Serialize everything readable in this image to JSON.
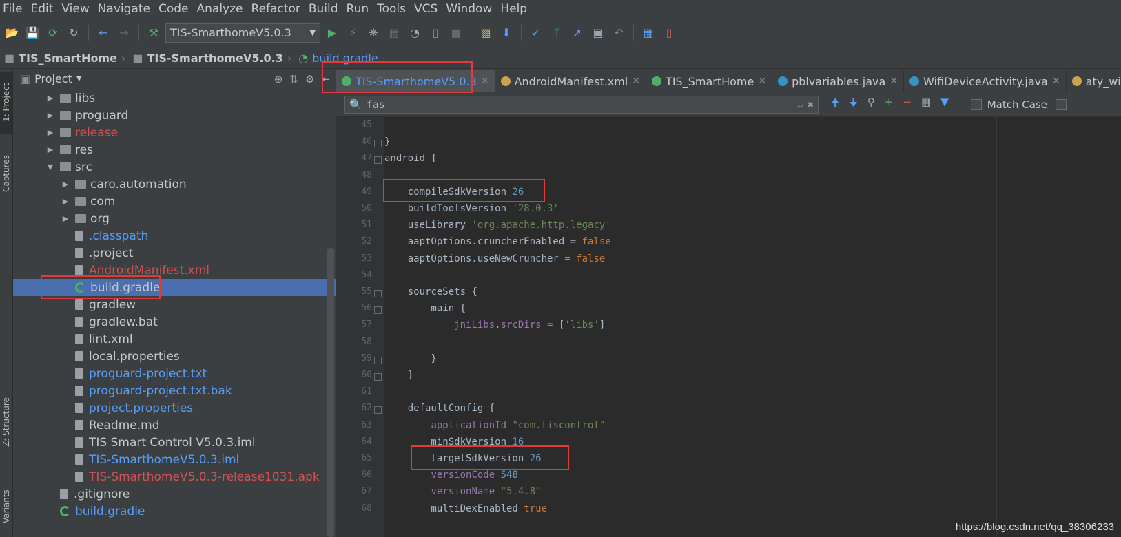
{
  "menu": [
    "File",
    "Edit",
    "View",
    "Navigate",
    "Code",
    "Analyze",
    "Refactor",
    "Build",
    "Run",
    "Tools",
    "VCS",
    "Window",
    "Help"
  ],
  "toolbar": {
    "run_config": "TIS-SmarthomeV5.0.3"
  },
  "breadcrumb": [
    "TIS_SmartHome",
    "TIS-SmarthomeV5.0.3",
    "build.gradle"
  ],
  "side_tabs": {
    "project": "1: Project",
    "captures": "Captures",
    "structure": "Z: Structure",
    "variants": "Variants"
  },
  "project_panel": {
    "title": "Project"
  },
  "tree": [
    {
      "label": "libs",
      "type": "folder",
      "indent": 1,
      "arrow": "▶",
      "color": "white"
    },
    {
      "label": "proguard",
      "type": "folder",
      "indent": 1,
      "arrow": "▶",
      "color": "white"
    },
    {
      "label": "release",
      "type": "folder",
      "indent": 1,
      "arrow": "▶",
      "color": "red"
    },
    {
      "label": "res",
      "type": "folder",
      "indent": 1,
      "arrow": "▶",
      "color": "white"
    },
    {
      "label": "src",
      "type": "folder",
      "indent": 1,
      "arrow": "▼",
      "color": "white"
    },
    {
      "label": "caro.automation",
      "type": "folder",
      "indent": 2,
      "arrow": "▶",
      "color": "white"
    },
    {
      "label": "com",
      "type": "folder",
      "indent": 2,
      "arrow": "▶",
      "color": "white"
    },
    {
      "label": "org",
      "type": "folder",
      "indent": 2,
      "arrow": "▶",
      "color": "white"
    },
    {
      "label": ".classpath",
      "type": "file",
      "indent": 2,
      "arrow": "",
      "color": "blue"
    },
    {
      "label": ".project",
      "type": "file",
      "indent": 2,
      "arrow": "",
      "color": "white"
    },
    {
      "label": "AndroidManifest.xml",
      "type": "file",
      "indent": 2,
      "arrow": "",
      "color": "red"
    },
    {
      "label": "build.gradle",
      "type": "gradle",
      "indent": 2,
      "arrow": "",
      "color": "white",
      "selected": true
    },
    {
      "label": "gradlew",
      "type": "file",
      "indent": 2,
      "arrow": "",
      "color": "white"
    },
    {
      "label": "gradlew.bat",
      "type": "file",
      "indent": 2,
      "arrow": "",
      "color": "white"
    },
    {
      "label": "lint.xml",
      "type": "file",
      "indent": 2,
      "arrow": "",
      "color": "white"
    },
    {
      "label": "local.properties",
      "type": "file",
      "indent": 2,
      "arrow": "",
      "color": "white"
    },
    {
      "label": "proguard-project.txt",
      "type": "file",
      "indent": 2,
      "arrow": "",
      "color": "blue"
    },
    {
      "label": "proguard-project.txt.bak",
      "type": "file",
      "indent": 2,
      "arrow": "",
      "color": "blue"
    },
    {
      "label": "project.properties",
      "type": "file",
      "indent": 2,
      "arrow": "",
      "color": "blue"
    },
    {
      "label": "Readme.md",
      "type": "file",
      "indent": 2,
      "arrow": "",
      "color": "white"
    },
    {
      "label": "TIS Smart Control V5.0.3.iml",
      "type": "file",
      "indent": 2,
      "arrow": "",
      "color": "white"
    },
    {
      "label": "TIS-SmarthomeV5.0.3.iml",
      "type": "file",
      "indent": 2,
      "arrow": "",
      "color": "blue"
    },
    {
      "label": "TIS-SmarthomeV5.0.3-release1031.apk",
      "type": "file",
      "indent": 2,
      "arrow": "",
      "color": "red"
    },
    {
      "label": ".gitignore",
      "type": "file",
      "indent": 1,
      "arrow": "",
      "color": "white"
    },
    {
      "label": "build.gradle",
      "type": "gradle",
      "indent": 1,
      "arrow": "",
      "color": "blue"
    }
  ],
  "editor_tabs": [
    {
      "label": "TIS-SmarthomeV5.0.3",
      "active": true,
      "icon_color": "#4fae6a"
    },
    {
      "label": "AndroidManifest.xml",
      "active": false,
      "icon_color": "#c9a34e"
    },
    {
      "label": "TIS_SmartHome",
      "active": false,
      "icon_color": "#4fae6a"
    },
    {
      "label": "pblvariables.java",
      "active": false,
      "icon_color": "#3592c4"
    },
    {
      "label": "WifiDeviceActivity.java",
      "active": false,
      "icon_color": "#3592c4"
    },
    {
      "label": "aty_wifi_de",
      "active": false,
      "icon_color": "#c9a34e"
    }
  ],
  "search": {
    "value": "fas",
    "match_case": "Match Case"
  },
  "code_lines": [
    {
      "n": "45",
      "parts": []
    },
    {
      "n": "46",
      "parts": [
        [
          "t",
          "}"
        ]
      ]
    },
    {
      "n": "47",
      "parts": [
        [
          "t",
          "android {"
        ]
      ]
    },
    {
      "n": "48",
      "parts": []
    },
    {
      "n": "49",
      "parts": [
        [
          "t",
          "    compileSdkVersion "
        ],
        [
          "num",
          "26"
        ]
      ]
    },
    {
      "n": "50",
      "parts": [
        [
          "t",
          "    buildToolsVersion "
        ],
        [
          "str",
          "'28.0.3'"
        ]
      ]
    },
    {
      "n": "51",
      "parts": [
        [
          "t",
          "    useLibrary "
        ],
        [
          "str",
          "'org.apache.http.legacy'"
        ]
      ]
    },
    {
      "n": "52",
      "parts": [
        [
          "t",
          "    aaptOptions.cruncherEnabled = "
        ],
        [
          "kw",
          "false"
        ]
      ]
    },
    {
      "n": "53",
      "parts": [
        [
          "t",
          "    aaptOptions.useNewCruncher = "
        ],
        [
          "kw",
          "false"
        ]
      ]
    },
    {
      "n": "54",
      "parts": []
    },
    {
      "n": "55",
      "parts": [
        [
          "t",
          "    sourceSets {"
        ]
      ]
    },
    {
      "n": "56",
      "parts": [
        [
          "t",
          "        main {"
        ]
      ]
    },
    {
      "n": "57",
      "parts": [
        [
          "t",
          "            "
        ],
        [
          "prop",
          "jniLibs"
        ],
        [
          "t",
          "."
        ],
        [
          "prop",
          "srcDirs"
        ],
        [
          "t",
          " = ["
        ],
        [
          "str",
          "'libs'"
        ],
        [
          "t",
          "]"
        ]
      ]
    },
    {
      "n": "58",
      "parts": []
    },
    {
      "n": "59",
      "parts": [
        [
          "t",
          "        }"
        ]
      ]
    },
    {
      "n": "60",
      "parts": [
        [
          "t",
          "    }"
        ]
      ]
    },
    {
      "n": "61",
      "parts": []
    },
    {
      "n": "62",
      "parts": [
        [
          "t",
          "    defaultConfig {"
        ]
      ]
    },
    {
      "n": "63",
      "parts": [
        [
          "t",
          "        "
        ],
        [
          "prop",
          "applicationId "
        ],
        [
          "str",
          "\"com.tiscontrol\""
        ]
      ]
    },
    {
      "n": "64",
      "parts": [
        [
          "t",
          "        minSdkVersion "
        ],
        [
          "num",
          "16"
        ]
      ]
    },
    {
      "n": "65",
      "parts": [
        [
          "t",
          "        targetSdkVersion "
        ],
        [
          "num",
          "26"
        ]
      ]
    },
    {
      "n": "66",
      "parts": [
        [
          "t",
          "        "
        ],
        [
          "prop",
          "versionCode "
        ],
        [
          "num",
          "548"
        ]
      ]
    },
    {
      "n": "67",
      "parts": [
        [
          "t",
          "        "
        ],
        [
          "prop",
          "versionName "
        ],
        [
          "str",
          "\"5.4.8\""
        ]
      ]
    },
    {
      "n": "68",
      "parts": [
        [
          "t",
          "        multiDexEnabled "
        ],
        [
          "kw",
          "true"
        ]
      ]
    }
  ],
  "watermark": "https://blog.csdn.net/qq_38306233"
}
